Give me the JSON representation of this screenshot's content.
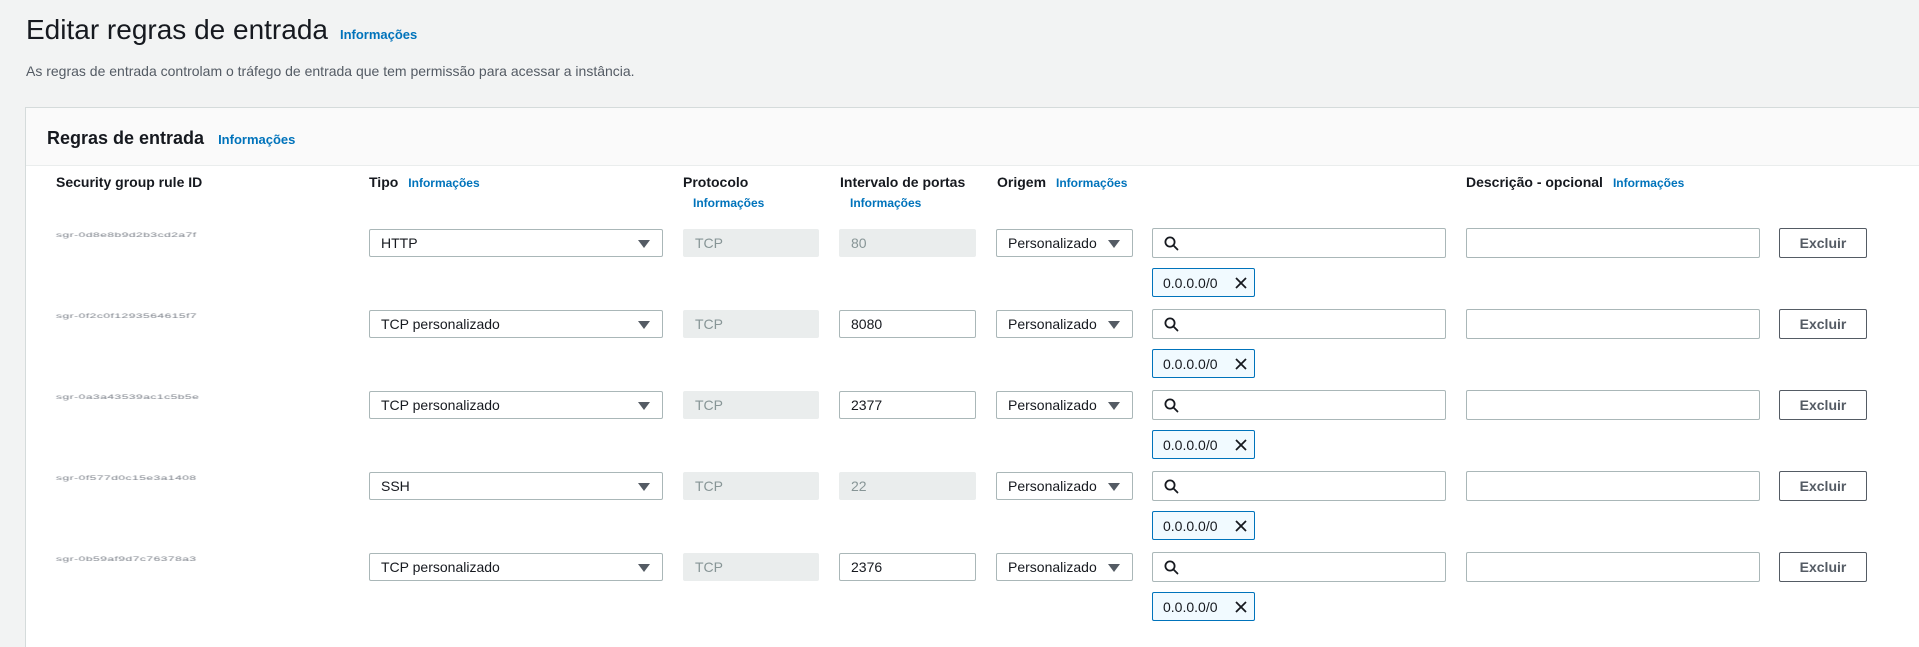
{
  "page": {
    "title": "Editar regras de entrada",
    "title_info": "Informações",
    "description": "As regras de entrada controlam o tráfego de entrada que tem permissão para acessar a instância."
  },
  "panel": {
    "title": "Regras de entrada",
    "info": "Informações"
  },
  "columns": {
    "rule_id": "Security group rule ID",
    "type": "Tipo",
    "type_info": "Informações",
    "protocol": "Protocolo",
    "protocol_info": "Informações",
    "port_range": "Intervalo de portas",
    "port_range_info": "Informações",
    "source": "Origem",
    "source_info": "Informações",
    "description": "Descrição - opcional",
    "description_info": "Informações"
  },
  "rules": [
    {
      "id": "sgr-0d8e8b9d2b3cd2a7f",
      "type": "HTTP",
      "protocol": "TCP",
      "port": "80",
      "port_editable": false,
      "source": "Personalizado",
      "search_value": "",
      "cidr": "0.0.0.0/0",
      "description": "",
      "delete_label": "Excluir"
    },
    {
      "id": "sgr-0f2c0f1293564615f7",
      "type": "TCP personalizado",
      "protocol": "TCP",
      "port": "8080",
      "port_editable": true,
      "source": "Personalizado",
      "search_value": "",
      "cidr": "0.0.0.0/0",
      "description": "",
      "delete_label": "Excluir"
    },
    {
      "id": "sgr-0a3a43539ac1c5b5e",
      "type": "TCP personalizado",
      "protocol": "TCP",
      "port": "2377",
      "port_editable": true,
      "source": "Personalizado",
      "search_value": "",
      "cidr": "0.0.0.0/0",
      "description": "",
      "delete_label": "Excluir"
    },
    {
      "id": "sgr-0f577d0c15e3a1408",
      "type": "SSH",
      "protocol": "TCP",
      "port": "22",
      "port_editable": false,
      "source": "Personalizado",
      "search_value": "",
      "cidr": "0.0.0.0/0",
      "description": "",
      "delete_label": "Excluir"
    },
    {
      "id": "sgr-0b59af9d7c76378a3",
      "type": "TCP personalizado",
      "protocol": "TCP",
      "port": "2376",
      "port_editable": true,
      "source": "Personalizado",
      "search_value": "",
      "cidr": "0.0.0.0/0",
      "description": "",
      "delete_label": "Excluir"
    }
  ],
  "icons": {
    "dropdown": "caret-down-icon",
    "search": "search-icon",
    "remove_token": "close-icon"
  },
  "colors": {
    "link": "#0073bb",
    "token_border": "#0073bb",
    "disabled_bg": "#eaeded"
  }
}
